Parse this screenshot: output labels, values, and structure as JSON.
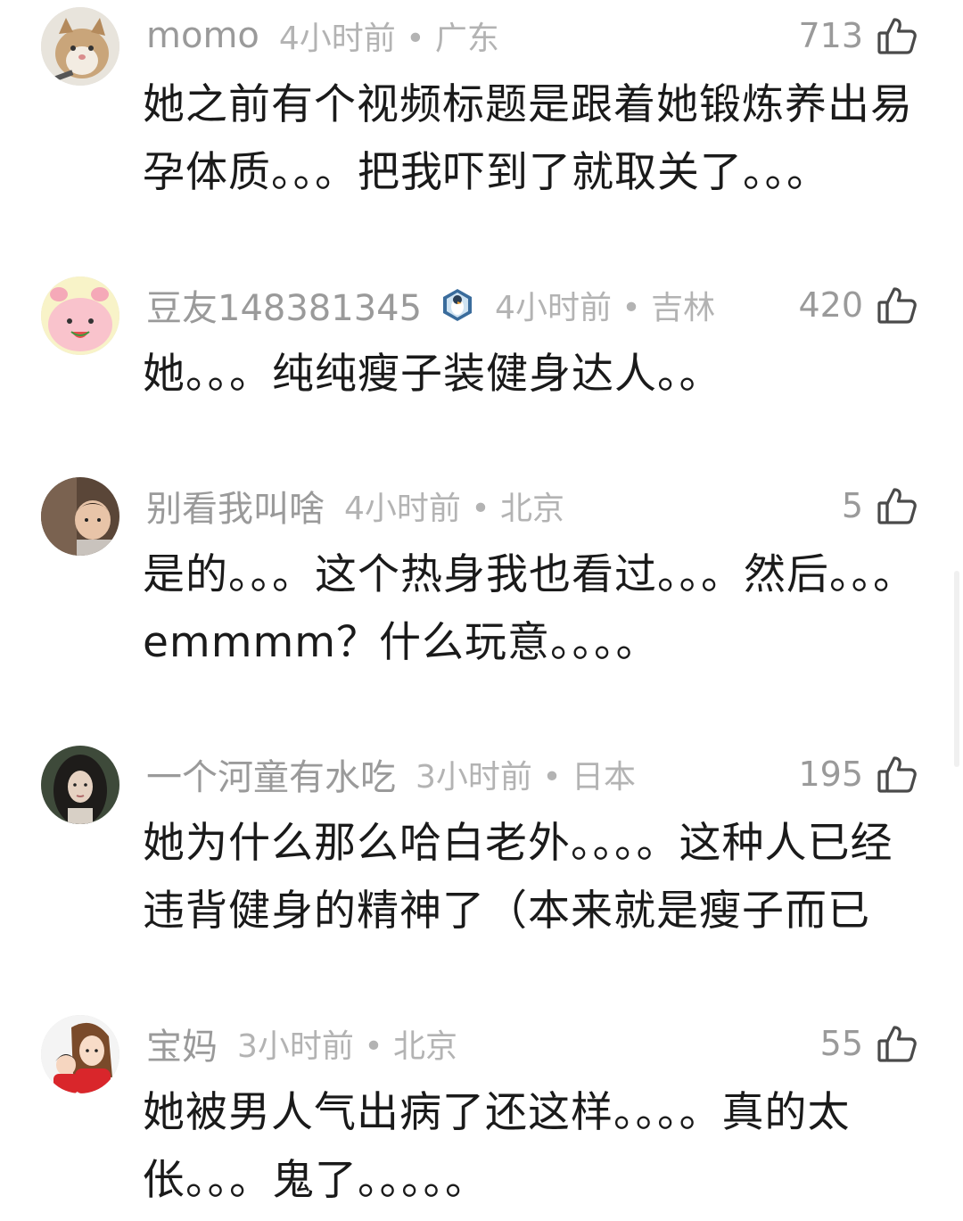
{
  "comments": [
    {
      "username": "momo",
      "time": "4小时前",
      "location": "广东",
      "likes": "713",
      "text": "她之前有个视频标题是跟着她锻炼养出易孕体质。。。把我吓到了就取关了。。。",
      "avatar": "cat-photo-avatar"
    },
    {
      "username": "豆友148381345",
      "time": "4小时前",
      "location": "吉林",
      "likes": "420",
      "text": "她。。。纯纯瘦子装健身达人。。",
      "avatar": "pink-cartoon-avatar",
      "badge": "penguin-badge-icon"
    },
    {
      "username": "别看我叫啥",
      "time": "4小时前",
      "location": "北京",
      "likes": "5",
      "text": "是的。。。这个热身我也看过。。。然后。。。emmmm？什么玩意。。。。",
      "avatar": "child-photo-avatar"
    },
    {
      "username": "一个河童有水吃",
      "time": "3小时前",
      "location": "日本",
      "likes": "195",
      "text": "她为什么那么哈白老外。。。。这种人已经违背健身的精神了（本来就是瘦子而已",
      "avatar": "woman-photo-avatar"
    },
    {
      "username": "宝妈",
      "time": "3小时前",
      "location": "北京",
      "likes": "55",
      "text": "她被男人气出病了还这样。。。。真的太伥。。。鬼了。。。。。",
      "avatar": "mother-child-cartoon-avatar"
    }
  ],
  "separator": " • ",
  "colors": {
    "username": "#9a9a9a",
    "meta": "#b3b3b3",
    "text": "#1a1a1a",
    "background": "#ffffff"
  }
}
